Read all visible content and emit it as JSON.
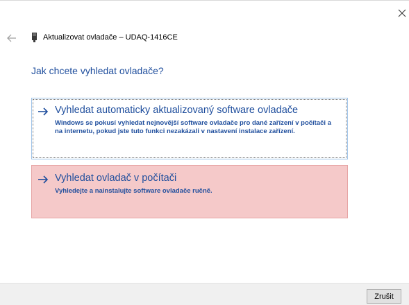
{
  "window": {
    "title": "Aktualizovat ovladače – UDAQ-1416CE",
    "close_icon": "close-icon",
    "back_icon": "back-arrow-icon",
    "device_icon": "device-icon"
  },
  "main": {
    "question": "Jak chcete vyhledat ovladače?",
    "options": [
      {
        "title": "Vyhledat automaticky aktualizovaný software ovladače",
        "description": "Windows se pokusí vyhledat nejnovější software ovladače pro dané zařízení v počítači a na internetu, pokud jste tuto funkci nezakázali v nastavení instalace zařízení.",
        "icon": "arrow-right-icon"
      },
      {
        "title": "Vyhledat ovladač v počítači",
        "description": "Vyhledejte a nainstalujte software ovladače ručně.",
        "icon": "arrow-right-icon"
      }
    ]
  },
  "footer": {
    "cancel_label": "Zrušit"
  },
  "colors": {
    "link_blue": "#1f4e9d",
    "highlight_red": "#f5c9c9",
    "focus_border": "#9fc3e8",
    "footer_bg": "#f0f0f0"
  }
}
